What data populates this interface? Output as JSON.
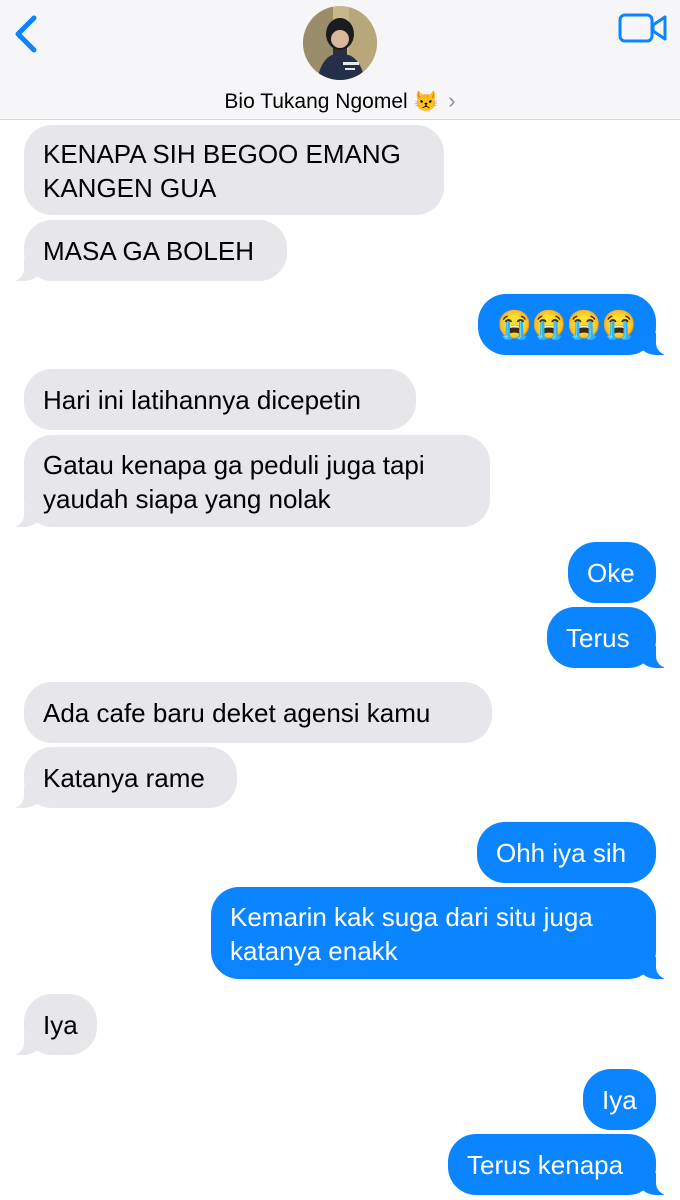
{
  "header": {
    "contact_name": "Bio Tukang Ngomel",
    "contact_emoji": "😾",
    "chevron": "›",
    "back_icon": "chevron-left",
    "video_icon": "video-camera",
    "accent": "#0a84ff"
  },
  "messages": [
    {
      "side": "in",
      "lines": [
        "KENAPA SIH BEGOO EMANG",
        "KANGEN GUA"
      ]
    },
    {
      "side": "in",
      "lines": [
        "MASA GA BOLEH"
      ]
    },
    {
      "side": "out",
      "lines": [
        "😭😭😭😭"
      ]
    },
    {
      "side": "in",
      "lines": [
        "Hari ini latihannya dicepetin"
      ]
    },
    {
      "side": "in",
      "lines": [
        "Gatau kenapa ga peduli juga tapi",
        "yaudah siapa yang nolak"
      ]
    },
    {
      "side": "out",
      "lines": [
        "Oke"
      ]
    },
    {
      "side": "out",
      "lines": [
        "Terus"
      ]
    },
    {
      "side": "in",
      "lines": [
        "Ada cafe baru deket agensi kamu"
      ]
    },
    {
      "side": "in",
      "lines": [
        "Katanya rame"
      ]
    },
    {
      "side": "out",
      "lines": [
        "Ohh iya sih"
      ]
    },
    {
      "side": "out",
      "lines": [
        "Kemarin kak suga dari situ juga",
        "katanya enakk"
      ]
    },
    {
      "side": "in",
      "lines": [
        "Iya"
      ]
    },
    {
      "side": "out",
      "lines": [
        "Iya"
      ]
    },
    {
      "side": "out",
      "lines": [
        "Terus kenapa"
      ]
    }
  ],
  "colors": {
    "incoming_bubble": "#e6e6eb",
    "outgoing_bubble": "#0a84ff",
    "header_bg": "#f6f6f8"
  }
}
